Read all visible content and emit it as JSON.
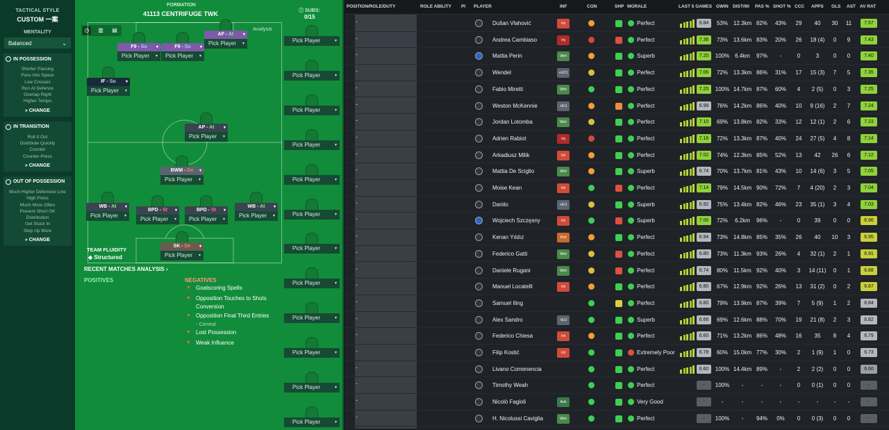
{
  "tactics": {
    "style_label": "TACTICAL STYLE",
    "style_value": "CUSTOM 一案",
    "mentality_label": "MENTALITY",
    "mentality_value": "Balanced",
    "in_possession": {
      "title": "IN POSSESSION",
      "items": [
        "Shorter Passing",
        "Pass Into Space",
        "Low Crosses",
        "Run At Defence",
        "Overlap Right",
        "Higher Tempo"
      ],
      "change": "CHANGE"
    },
    "in_transition": {
      "title": "IN TRANSITION",
      "items": [
        "Roll It Out",
        "Distribute Quickly",
        "Counter",
        "Counter-Press"
      ],
      "change": "CHANGE"
    },
    "out_of_possession": {
      "title": "OUT OF POSSESSION",
      "items": [
        "Much Higher Defensive Line",
        "High Press",
        "Much More Often",
        "Prevent Short GK",
        "Distribution",
        "Get Stuck In",
        "Step Up More"
      ],
      "change": "CHANGE"
    }
  },
  "formation": {
    "label": "FORMATION",
    "name": "41113 CENTRIFUGE TWK",
    "analysis": "Analysis",
    "subs_label": "SUBS:",
    "subs_count": "0/15",
    "pick_label": "Pick Player",
    "fluidity_label": "TEAM FLUIDITY",
    "fluidity_value": "Structured",
    "recent_matches": "RECENT MATCHES ANALYSIS ›",
    "positives_label": "POSITIVES",
    "negatives_label": "NEGATIVES",
    "negatives": [
      "Goalscoring Spells",
      "Opposition Touches to Shots Conversion",
      "Opposition Final Third Entries",
      "Lost Possession",
      "Weak Influence"
    ],
    "negatives_sub": "- Central",
    "positions": [
      {
        "role": "AF",
        "duty": "At"
      },
      {
        "role": "F9",
        "duty": "Su"
      },
      {
        "role": "F9",
        "duty": "Su"
      },
      {
        "role": "IF",
        "duty": "Su"
      },
      {
        "role": "AP",
        "duty": "At"
      },
      {
        "role": "BWM",
        "duty": "De"
      },
      {
        "role": "WB",
        "duty": "At"
      },
      {
        "role": "BPD",
        "duty": "St"
      },
      {
        "role": "BPD",
        "duty": "St"
      },
      {
        "role": "WB",
        "duty": "At"
      },
      {
        "role": "SK",
        "duty": "De"
      }
    ]
  },
  "table": {
    "headers": [
      "POSITION/ROLE/DUTY",
      "ROLE ABILITY",
      "PI",
      "PLAYER",
      "INF",
      "CON",
      "SHP",
      "MORALE",
      "LAST 5 GAMES",
      "GWIN",
      "DIST/90",
      "PAS %",
      "SHOT %",
      "CCC",
      "APPS",
      "GLS",
      "AST",
      "AV RAT"
    ],
    "rows": [
      {
        "name": "Dušan Vlahović",
        "inf": "Int",
        "morale": "Perfect",
        "last": "6.84",
        "gwin": "53%",
        "dist": "12.3km",
        "pas": "82%",
        "shot": "43%",
        "ccc": "29",
        "apps": "40",
        "gls": "30",
        "ast": "11",
        "avr": "7.57"
      },
      {
        "name": "Andrea Cambiaso",
        "inf": "Inj",
        "morale": "Perfect",
        "last": "7.36",
        "gwin": "73%",
        "dist": "13.6km",
        "pas": "83%",
        "shot": "20%",
        "ccc": "26",
        "apps": "18 (4)",
        "gls": "0",
        "ast": "9",
        "avr": "7.43"
      },
      {
        "name": "Mattia Perin",
        "inf": "Wnt",
        "morale": "Superb",
        "last": "7.20",
        "gwin": "100%",
        "dist": "6.4km",
        "pas": "97%",
        "shot": "-",
        "ccc": "0",
        "apps": "3",
        "gls": "0",
        "ast": "0",
        "avr": "7.40"
      },
      {
        "name": "Wendel",
        "inf": "+U21",
        "morale": "Perfect",
        "last": "7.06",
        "gwin": "72%",
        "dist": "13.3km",
        "pas": "86%",
        "shot": "31%",
        "ccc": "17",
        "apps": "15 (3)",
        "gls": "7",
        "ast": "5",
        "avr": "7.35"
      },
      {
        "name": "Fabio Miretti",
        "inf": "Wnt",
        "morale": "Perfect",
        "last": "7.25",
        "gwin": "100%",
        "dist": "14.7km",
        "pas": "87%",
        "shot": "60%",
        "ccc": "4",
        "apps": "2 (5)",
        "gls": "0",
        "ast": "3",
        "avr": "7.25"
      },
      {
        "name": "Weston McKennie",
        "inf": "+EU",
        "morale": "Perfect",
        "last": "6.98",
        "gwin": "76%",
        "dist": "14.2km",
        "pas": "86%",
        "shot": "40%",
        "ccc": "10",
        "apps": "9 (16)",
        "gls": "2",
        "ast": "7",
        "avr": "7.24"
      },
      {
        "name": "Jordan Lotomba",
        "inf": "Wnt",
        "morale": "Perfect",
        "last": "7.10",
        "gwin": "69%",
        "dist": "13.8km",
        "pas": "82%",
        "shot": "33%",
        "ccc": "12",
        "apps": "12 (1)",
        "gls": "2",
        "ast": "6",
        "avr": "7.23"
      },
      {
        "name": "Adrien Rabiot",
        "inf": "Inj",
        "morale": "Perfect",
        "last": "7.16",
        "gwin": "72%",
        "dist": "13.3km",
        "pas": "87%",
        "shot": "40%",
        "ccc": "24",
        "apps": "27 (5)",
        "gls": "4",
        "ast": "8",
        "avr": "7.14"
      },
      {
        "name": "Arkadiusz Milik",
        "inf": "Int",
        "morale": "Perfect",
        "last": "7.02",
        "gwin": "74%",
        "dist": "12.3km",
        "pas": "85%",
        "shot": "52%",
        "ccc": "13",
        "apps": "42",
        "gls": "26",
        "ast": "6",
        "avr": "7.12"
      },
      {
        "name": "Mattia De Sciglio",
        "inf": "Wnt",
        "morale": "Superb",
        "last": "6.74",
        "gwin": "70%",
        "dist": "13.7km",
        "pas": "81%",
        "shot": "43%",
        "ccc": "10",
        "apps": "14 (6)",
        "gls": "3",
        "ast": "5",
        "avr": "7.05"
      },
      {
        "name": "Moise Kean",
        "inf": "Int",
        "morale": "Perfect",
        "last": "7.14",
        "gwin": "79%",
        "dist": "14.5km",
        "pas": "90%",
        "shot": "72%",
        "ccc": "7",
        "apps": "4 (20)",
        "gls": "2",
        "ast": "3",
        "avr": "7.04"
      },
      {
        "name": "Danilo",
        "inf": "+EU",
        "morale": "Superb",
        "last": "6.92",
        "gwin": "75%",
        "dist": "13.4km",
        "pas": "82%",
        "shot": "46%",
        "ccc": "23",
        "apps": "35 (1)",
        "gls": "3",
        "ast": "4",
        "avr": "7.03"
      },
      {
        "name": "Wojciech Szczęsny",
        "inf": "Int",
        "morale": "Superb",
        "last": "7.00",
        "gwin": "72%",
        "dist": "6.2km",
        "pas": "96%",
        "shot": "-",
        "ccc": "0",
        "apps": "39",
        "gls": "0",
        "ast": "0",
        "avr": "6.96"
      },
      {
        "name": "Kenan Yıldız",
        "inf": "Rot",
        "morale": "Perfect",
        "last": "6.94",
        "gwin": "73%",
        "dist": "14.8km",
        "pas": "85%",
        "shot": "35%",
        "ccc": "26",
        "apps": "40",
        "gls": "10",
        "ast": "3",
        "avr": "6.95"
      },
      {
        "name": "Federico Gatti",
        "inf": "Wnt",
        "morale": "Perfect",
        "last": "6.80",
        "gwin": "73%",
        "dist": "11.3km",
        "pas": "93%",
        "shot": "26%",
        "ccc": "4",
        "apps": "32 (1)",
        "gls": "2",
        "ast": "1",
        "avr": "6.91"
      },
      {
        "name": "Daniele Rugani",
        "inf": "Wnt",
        "morale": "Perfect",
        "last": "6.74",
        "gwin": "80%",
        "dist": "11.5km",
        "pas": "92%",
        "shot": "40%",
        "ccc": "3",
        "apps": "14 (11)",
        "gls": "0",
        "ast": "1",
        "avr": "6.88"
      },
      {
        "name": "Manuel Locatelli",
        "inf": "Int",
        "morale": "Perfect",
        "last": "6.80",
        "gwin": "67%",
        "dist": "12.9km",
        "pas": "92%",
        "shot": "26%",
        "ccc": "13",
        "apps": "31 (2)",
        "gls": "0",
        "ast": "2",
        "avr": "6.87"
      },
      {
        "name": "Samuel Iling",
        "inf": "",
        "morale": "Perfect",
        "last": "6.80",
        "gwin": "79%",
        "dist": "13.9km",
        "pas": "87%",
        "shot": "39%",
        "ccc": "7",
        "apps": "5 (9)",
        "gls": "1",
        "ast": "2",
        "avr": "6.84"
      },
      {
        "name": "Alex Sandro",
        "inf": "+EU",
        "morale": "Superb",
        "last": "6.66",
        "gwin": "69%",
        "dist": "12.6km",
        "pas": "88%",
        "shot": "70%",
        "ccc": "19",
        "apps": "21 (8)",
        "gls": "2",
        "ast": "3",
        "avr": "6.82"
      },
      {
        "name": "Federico Chiesa",
        "inf": "Int",
        "morale": "Perfect",
        "last": "6.60",
        "gwin": "71%",
        "dist": "13.2km",
        "pas": "86%",
        "shot": "48%",
        "ccc": "16",
        "apps": "35",
        "gls": "8",
        "ast": "4",
        "avr": "6.79"
      },
      {
        "name": "Filip Kostić",
        "inf": "Int",
        "morale": "Extremely Poor",
        "last": "6.78",
        "gwin": "60%",
        "dist": "15.0km",
        "pas": "77%",
        "shot": "30%",
        "ccc": "2",
        "apps": "1 (9)",
        "gls": "1",
        "ast": "0",
        "avr": "6.73"
      },
      {
        "name": "Livano Comenencia",
        "inf": "",
        "morale": "Perfect",
        "last": "6.60",
        "gwin": "100%",
        "dist": "14.4km",
        "pas": "89%",
        "shot": "-",
        "ccc": "2",
        "apps": "2 (2)",
        "gls": "0",
        "ast": "0",
        "avr": "6.60"
      },
      {
        "name": "Timothy Weah",
        "inf": "",
        "morale": "Perfect",
        "last": "-",
        "gwin": "100%",
        "dist": "-",
        "pas": "-",
        "shot": "-",
        "ccc": "0",
        "apps": "0 (1)",
        "gls": "0",
        "ast": "0",
        "avr": "-"
      },
      {
        "name": "Nicolò Fagioli",
        "inf": "Ask",
        "morale": "Very Good",
        "last": "-",
        "gwin": "-",
        "dist": "-",
        "pas": "-",
        "shot": "-",
        "ccc": "-",
        "apps": "-",
        "gls": "-",
        "ast": "-",
        "avr": "-"
      },
      {
        "name": "H. Nicolussi Caviglia",
        "inf": "Wnt",
        "morale": "Perfect",
        "last": "-",
        "gwin": "100%",
        "dist": "-",
        "pas": "94%",
        "shot": "0%",
        "ccc": "0",
        "apps": "0 (3)",
        "gls": "0",
        "ast": "0",
        "avr": "-"
      }
    ]
  }
}
